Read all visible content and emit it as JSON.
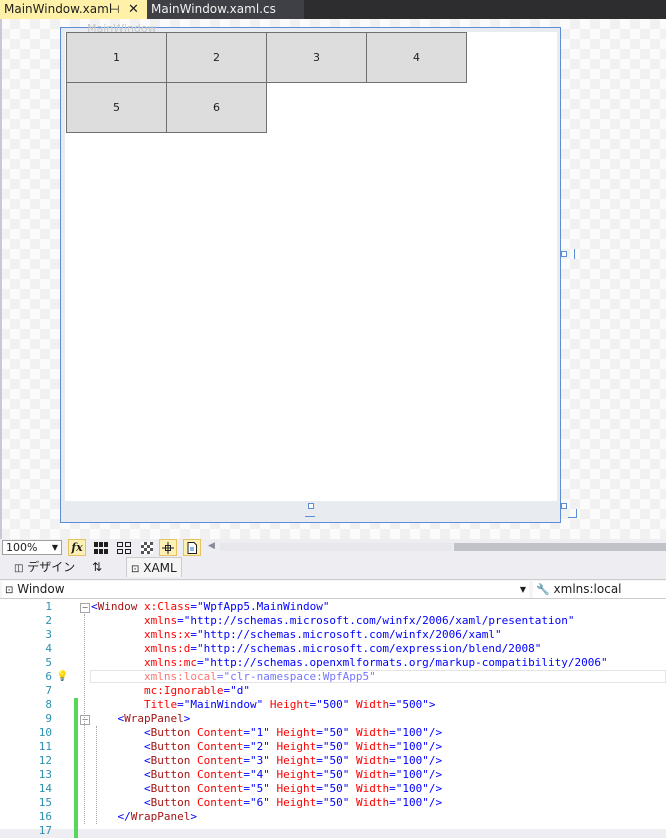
{
  "tabs": [
    {
      "label": "MainWindow.xaml",
      "active": true,
      "pin": "⊣",
      "close": "✕"
    },
    {
      "label": "MainWindow.xaml.cs",
      "active": false
    }
  ],
  "designer": {
    "window_title": "MainWindow",
    "buttons": [
      "1",
      "2",
      "3",
      "4",
      "5",
      "6"
    ]
  },
  "toolbar": {
    "zoom": "100%",
    "fx_label": "fx"
  },
  "split_tabs": {
    "design": "デザイン",
    "swap": "⇅",
    "xaml": "XAML"
  },
  "navbar": {
    "left": "Window",
    "right": "xmlns:local"
  },
  "editor": {
    "line_numbers": [
      "1",
      "2",
      "3",
      "4",
      "5",
      "6",
      "7",
      "8",
      "9",
      "10",
      "11",
      "12",
      "13",
      "14",
      "15",
      "16",
      "17"
    ],
    "lines": [
      {
        "indent": "",
        "parts": [
          [
            "br",
            "<"
          ],
          [
            "el",
            "Window"
          ],
          [
            "at",
            " x:Class"
          ],
          [
            "br",
            "="
          ],
          [
            "v",
            "\"WpfApp5.MainWindow\""
          ]
        ]
      },
      {
        "indent": "        ",
        "parts": [
          [
            "at",
            "xmlns"
          ],
          [
            "br",
            "="
          ],
          [
            "v",
            "\"http://schemas.microsoft.com/winfx/2006/xaml/presentation\""
          ]
        ]
      },
      {
        "indent": "        ",
        "parts": [
          [
            "at",
            "xmlns:x"
          ],
          [
            "br",
            "="
          ],
          [
            "v",
            "\"http://schemas.microsoft.com/winfx/2006/xaml\""
          ]
        ]
      },
      {
        "indent": "        ",
        "parts": [
          [
            "at",
            "xmlns:d"
          ],
          [
            "br",
            "="
          ],
          [
            "v",
            "\"http://schemas.microsoft.com/expression/blend/2008\""
          ]
        ]
      },
      {
        "indent": "        ",
        "parts": [
          [
            "at",
            "xmlns:mc"
          ],
          [
            "br",
            "="
          ],
          [
            "v",
            "\"http://schemas.openxmlformats.org/markup-compatibility/2006\""
          ]
        ]
      },
      {
        "indent": "        ",
        "parts": [
          [
            "at",
            "xmlns:local"
          ],
          [
            "br",
            "="
          ],
          [
            "v",
            "\"clr-namespace:WpfApp5\""
          ]
        ]
      },
      {
        "indent": "        ",
        "parts": [
          [
            "at",
            "mc:Ignorable"
          ],
          [
            "br",
            "="
          ],
          [
            "v",
            "\"d\""
          ]
        ]
      },
      {
        "indent": "        ",
        "parts": [
          [
            "at",
            "Title"
          ],
          [
            "br",
            "="
          ],
          [
            "v",
            "\"MainWindow\""
          ],
          [
            "at",
            " Height"
          ],
          [
            "br",
            "="
          ],
          [
            "v",
            "\"500\""
          ],
          [
            "at",
            " Width"
          ],
          [
            "br",
            "="
          ],
          [
            "v",
            "\"500\""
          ],
          [
            "br",
            ">"
          ]
        ]
      },
      {
        "indent": "    ",
        "parts": [
          [
            "br",
            "<"
          ],
          [
            "el",
            "WrapPanel"
          ],
          [
            "br",
            ">"
          ]
        ]
      },
      {
        "indent": "        ",
        "parts": [
          [
            "br",
            "<"
          ],
          [
            "el",
            "Button"
          ],
          [
            "at",
            " Content"
          ],
          [
            "br",
            "="
          ],
          [
            "v",
            "\"1\""
          ],
          [
            "at",
            " Height"
          ],
          [
            "br",
            "="
          ],
          [
            "v",
            "\"50\""
          ],
          [
            "at",
            " Width"
          ],
          [
            "br",
            "="
          ],
          [
            "v",
            "\"100\""
          ],
          [
            "br",
            "/>"
          ]
        ]
      },
      {
        "indent": "        ",
        "parts": [
          [
            "br",
            "<"
          ],
          [
            "el",
            "Button"
          ],
          [
            "at",
            " Content"
          ],
          [
            "br",
            "="
          ],
          [
            "v",
            "\"2\""
          ],
          [
            "at",
            " Height"
          ],
          [
            "br",
            "="
          ],
          [
            "v",
            "\"50\""
          ],
          [
            "at",
            " Width"
          ],
          [
            "br",
            "="
          ],
          [
            "v",
            "\"100\""
          ],
          [
            "br",
            "/>"
          ]
        ]
      },
      {
        "indent": "        ",
        "parts": [
          [
            "br",
            "<"
          ],
          [
            "el",
            "Button"
          ],
          [
            "at",
            " Content"
          ],
          [
            "br",
            "="
          ],
          [
            "v",
            "\"3\""
          ],
          [
            "at",
            " Height"
          ],
          [
            "br",
            "="
          ],
          [
            "v",
            "\"50\""
          ],
          [
            "at",
            " Width"
          ],
          [
            "br",
            "="
          ],
          [
            "v",
            "\"100\""
          ],
          [
            "br",
            "/>"
          ]
        ]
      },
      {
        "indent": "        ",
        "parts": [
          [
            "br",
            "<"
          ],
          [
            "el",
            "Button"
          ],
          [
            "at",
            " Content"
          ],
          [
            "br",
            "="
          ],
          [
            "v",
            "\"4\""
          ],
          [
            "at",
            " Height"
          ],
          [
            "br",
            "="
          ],
          [
            "v",
            "\"50\""
          ],
          [
            "at",
            " Width"
          ],
          [
            "br",
            "="
          ],
          [
            "v",
            "\"100\""
          ],
          [
            "br",
            "/>"
          ]
        ]
      },
      {
        "indent": "        ",
        "parts": [
          [
            "br",
            "<"
          ],
          [
            "el",
            "Button"
          ],
          [
            "at",
            " Content"
          ],
          [
            "br",
            "="
          ],
          [
            "v",
            "\"5\""
          ],
          [
            "at",
            " Height"
          ],
          [
            "br",
            "="
          ],
          [
            "v",
            "\"50\""
          ],
          [
            "at",
            " Width"
          ],
          [
            "br",
            "="
          ],
          [
            "v",
            "\"100\""
          ],
          [
            "br",
            "/>"
          ]
        ]
      },
      {
        "indent": "        ",
        "parts": [
          [
            "br",
            "<"
          ],
          [
            "el",
            "Button"
          ],
          [
            "at",
            " Content"
          ],
          [
            "br",
            "="
          ],
          [
            "v",
            "\"6\""
          ],
          [
            "at",
            " Height"
          ],
          [
            "br",
            "="
          ],
          [
            "v",
            "\"50\""
          ],
          [
            "at",
            " Width"
          ],
          [
            "br",
            "="
          ],
          [
            "v",
            "\"100\""
          ],
          [
            "br",
            "/>"
          ]
        ]
      },
      {
        "indent": "    ",
        "parts": [
          [
            "br",
            "</"
          ],
          [
            "el",
            "WrapPanel"
          ],
          [
            "br",
            ">"
          ]
        ]
      },
      {
        "indent": "",
        "parts": []
      }
    ]
  }
}
